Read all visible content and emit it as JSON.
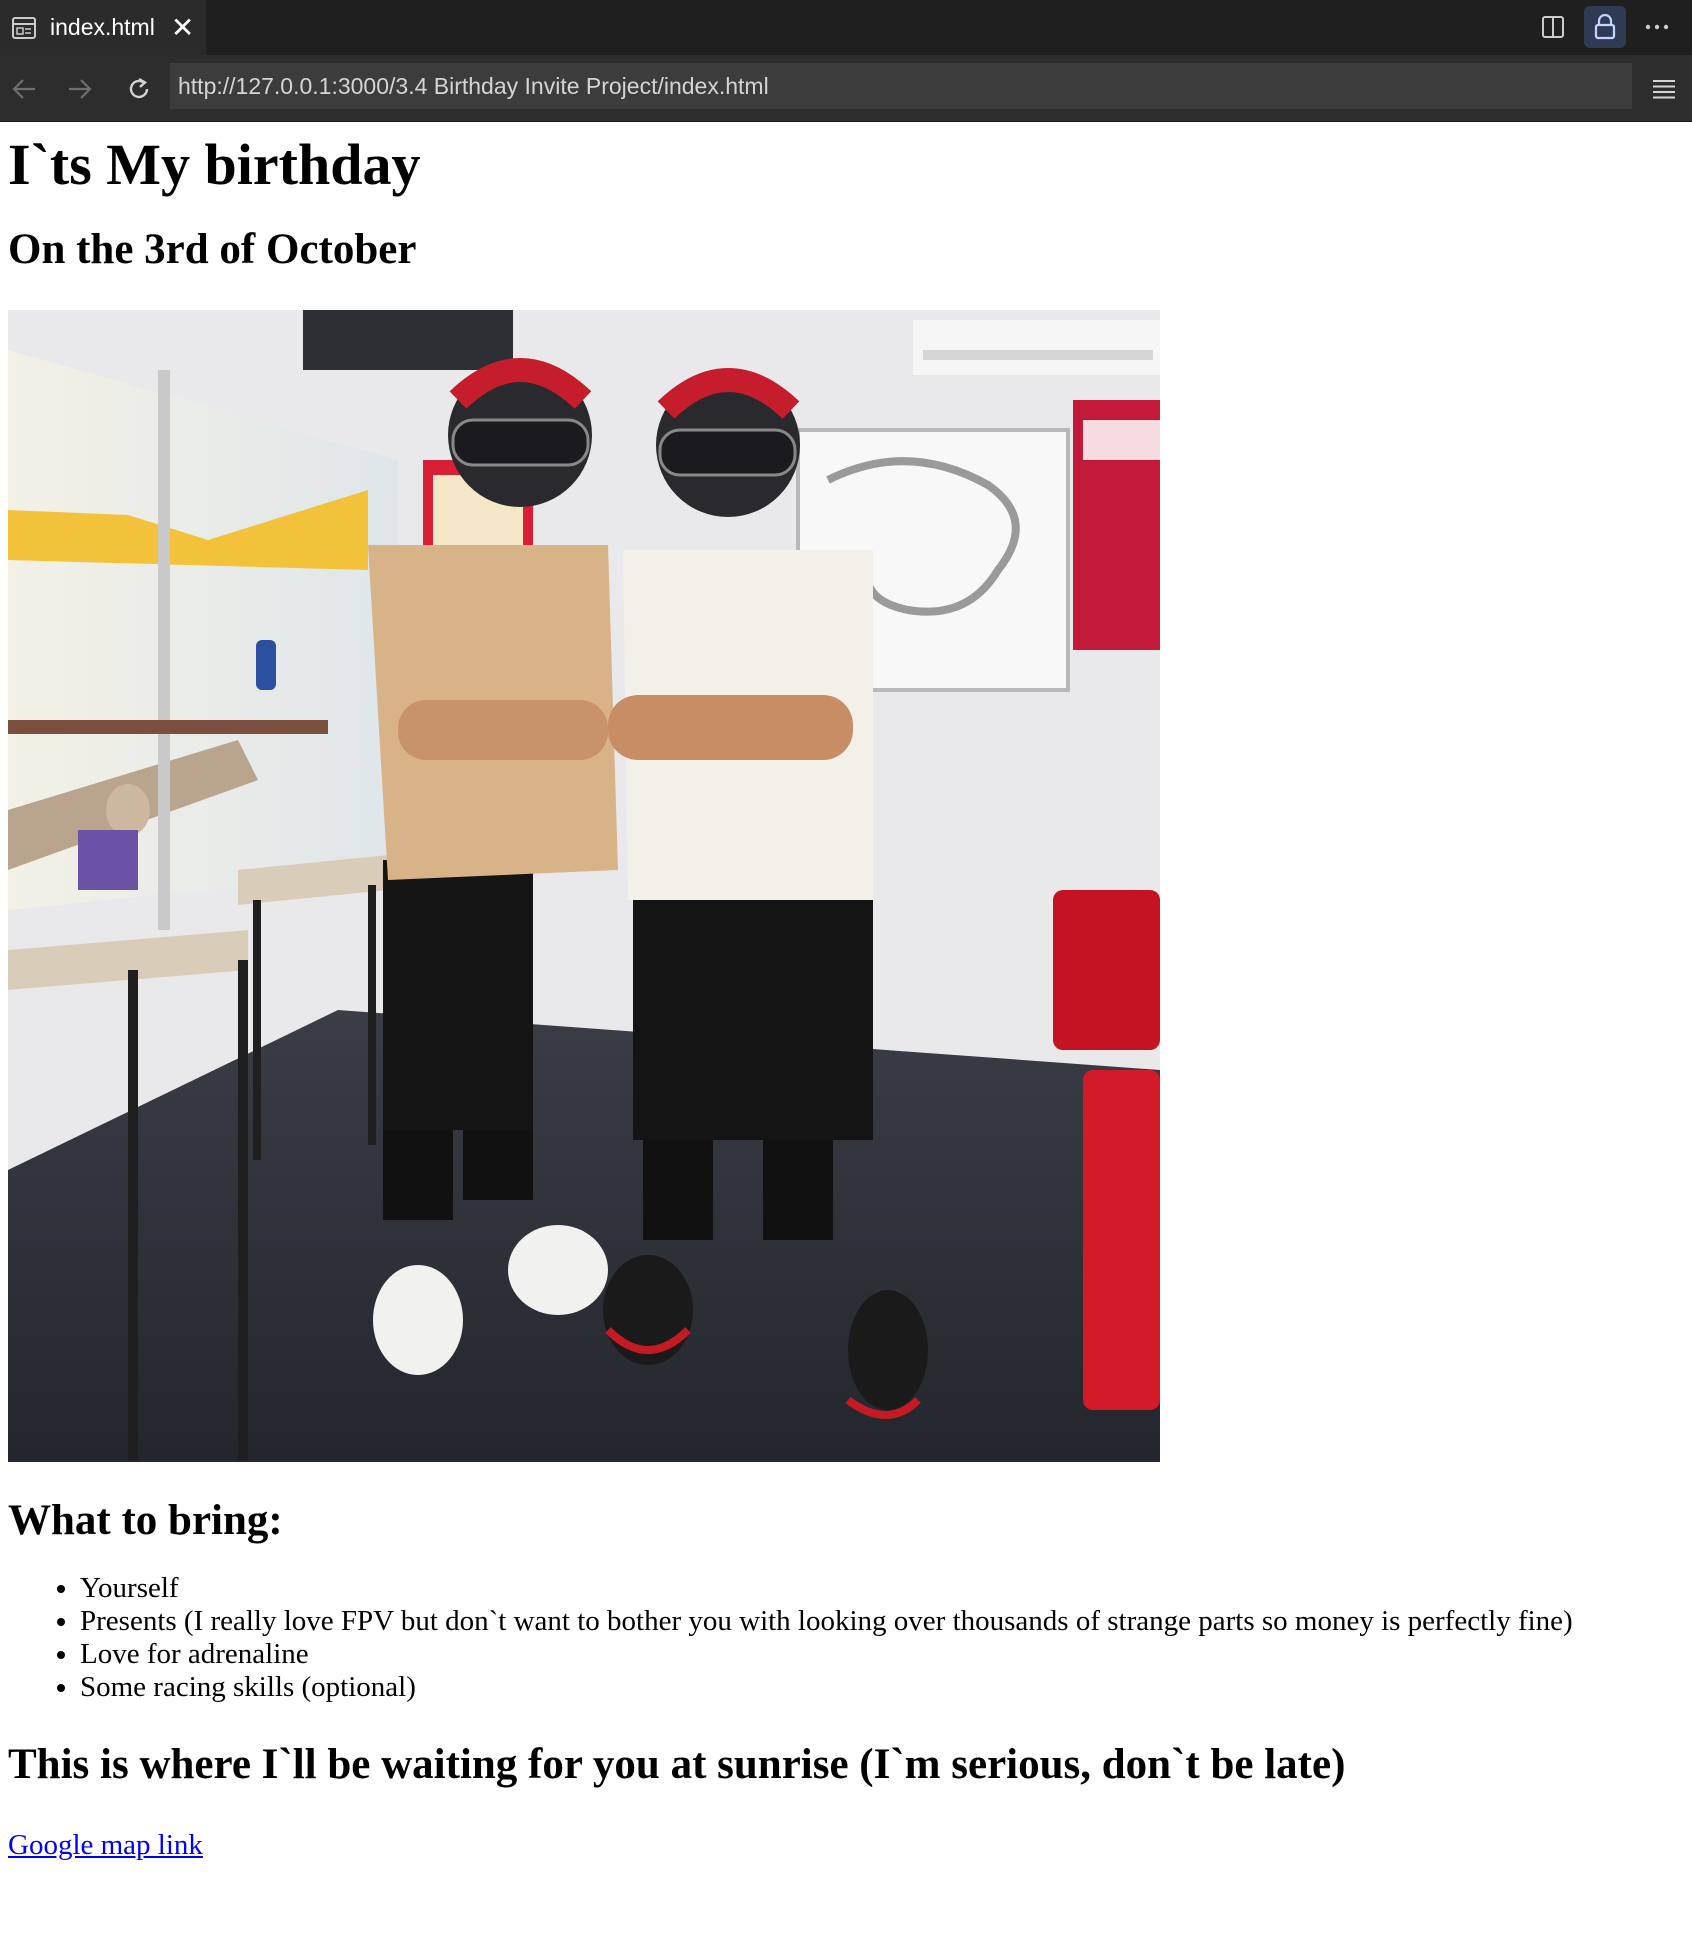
{
  "browser": {
    "tab_title": "index.html",
    "url": "http://127.0.0.1:3000/3.4 Birthday Invite Project/index.html",
    "icons": [
      "file-icon",
      "close-icon",
      "split-view-icon",
      "lock-icon",
      "more-icon",
      "back-icon",
      "forward-icon",
      "reload-icon",
      "menu-icon"
    ]
  },
  "page": {
    "title": "I`ts My birthday",
    "date": "On the 3rd of October",
    "photo_alt": "Two friends in racing helmets at a karting venue",
    "bring_heading": "What to bring:",
    "bring_items": [
      "Yourself",
      "Presents (I really love FPV but don`t want to bother you with looking over thousands of strange parts so money is perfectly fine)",
      "Love for adrenaline",
      "Some racing skills (optional)"
    ],
    "where_heading": "This is where I`ll be waiting for you at sunrise (I`m serious, don`t be late)",
    "map_link": "Google map link"
  },
  "colors": {
    "tabbar_bg": "#1f1f1f",
    "navbar_bg": "#2d2d2d",
    "url_bg": "#3c3c3c",
    "link": "#0000ee"
  }
}
